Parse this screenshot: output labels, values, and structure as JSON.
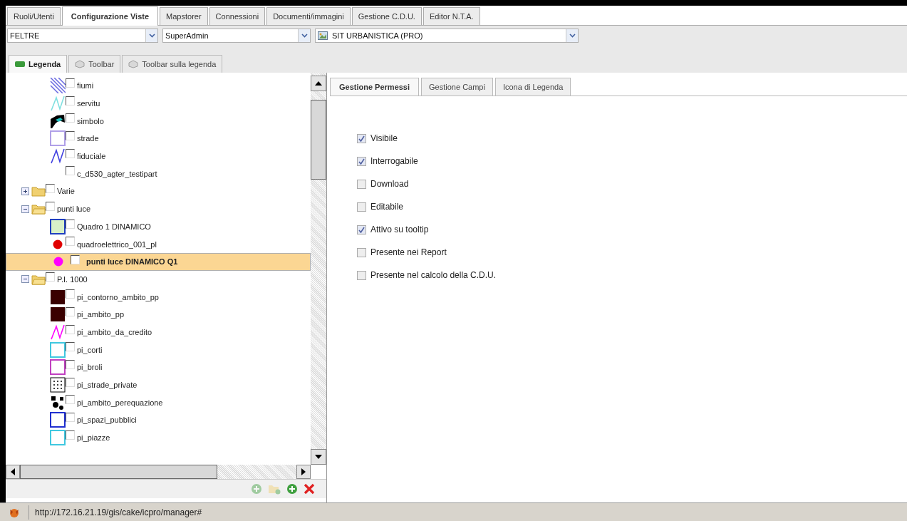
{
  "top_tabs": [
    {
      "label": "Ruoli/Utenti",
      "selected": false
    },
    {
      "label": "Configurazione Viste",
      "selected": true
    },
    {
      "label": "Mapstorer",
      "selected": false
    },
    {
      "label": "Connessioni",
      "selected": false
    },
    {
      "label": "Documenti/immagini",
      "selected": false
    },
    {
      "label": "Gestione C.D.U.",
      "selected": false
    },
    {
      "label": "Editor N.T.A.",
      "selected": false
    }
  ],
  "selectors": [
    {
      "value": "FELTRE",
      "kind": "plain"
    },
    {
      "value": "SuperAdmin",
      "kind": "plain"
    },
    {
      "value": "SIT URBANISTICA (PRO)",
      "kind": "icon"
    }
  ],
  "legend_tabs": [
    {
      "label": "Legenda",
      "selected": true
    },
    {
      "label": "Toolbar",
      "selected": false
    },
    {
      "label": "Toolbar sulla legenda",
      "selected": false
    }
  ],
  "tree": [
    {
      "children": [
        {
          "label": "fiumi",
          "kind": "hatch",
          "color": "#6a6ae0",
          "checked": false,
          "selected": false
        },
        {
          "label": "servitu",
          "kind": "line",
          "color": "#80e0e0",
          "checked": false,
          "selected": false
        },
        {
          "label": "simbolo",
          "kind": "blob-accent",
          "checked": false,
          "selected": false
        },
        {
          "label": "strade",
          "kind": "square",
          "color": "#b0a0e8",
          "checked": false,
          "selected": false
        },
        {
          "label": "fiduciale",
          "kind": "line",
          "color": "#4040e0",
          "checked": false,
          "selected": false
        },
        {
          "label": "c_d530_agter_testipart",
          "kind": "none",
          "checked": false,
          "selected": false
        }
      ]
    },
    {
      "label": "Varie",
      "kind": "folder",
      "expanded": false,
      "checked": false,
      "selected": false
    },
    {
      "label": "punti luce",
      "kind": "folder",
      "expanded": true,
      "checked": false,
      "selected": false,
      "children": [
        {
          "label": "Quadro 1 DINAMICO",
          "kind": "filled-square",
          "color": "#2040c0",
          "checked": false,
          "selected": false
        },
        {
          "label": "quadroelettrico_001_pl",
          "kind": "dot",
          "color": "#e00000",
          "checked": false,
          "selected": false
        },
        {
          "label": "punti luce DINAMICO Q1",
          "kind": "dot",
          "color": "#ff00ff",
          "checked": false,
          "selected": true
        }
      ]
    },
    {
      "label": "P.I. 1000",
      "kind": "folder",
      "expanded": true,
      "checked": false,
      "selected": false,
      "children": [
        {
          "label": "pi_contorno_ambito_pp",
          "kind": "solid",
          "color": "#3a0000",
          "checked": false,
          "selected": false
        },
        {
          "label": "pi_ambito_pp",
          "kind": "solid",
          "color": "#3a0000",
          "checked": false,
          "selected": false
        },
        {
          "label": "pi_ambito_da_credito",
          "kind": "line",
          "color": "#ff00ff",
          "checked": false,
          "selected": false
        },
        {
          "label": "pi_corti",
          "kind": "square",
          "color": "#40c8e0",
          "checked": false,
          "selected": false
        },
        {
          "label": "pi_broli",
          "kind": "square",
          "color": "#c040c0",
          "checked": false,
          "selected": false
        },
        {
          "label": "pi_strade_private",
          "kind": "dotgrid",
          "checked": false,
          "selected": false
        },
        {
          "label": "pi_ambito_perequazione",
          "kind": "blob",
          "checked": false,
          "selected": false
        },
        {
          "label": "pi_spazi_pubblici",
          "kind": "square",
          "color": "#2030d0",
          "checked": false,
          "selected": false
        },
        {
          "label": "pi_piazze",
          "kind": "square",
          "color": "#40c8e0",
          "checked": false,
          "selected": false
        }
      ]
    }
  ],
  "tree_actions": [
    {
      "kind": "add",
      "disabled": true
    },
    {
      "kind": "folder-add",
      "disabled": true
    },
    {
      "kind": "add",
      "disabled": false
    },
    {
      "kind": "delete",
      "disabled": false
    }
  ],
  "detail_tabs": [
    {
      "label": "Gestione Permessi",
      "selected": true
    },
    {
      "label": "Gestione Campi",
      "selected": false
    },
    {
      "label": "Icona di Legenda",
      "selected": false
    }
  ],
  "permissions": [
    {
      "label": "Visibile",
      "checked": true
    },
    {
      "label": "Interrogabile",
      "checked": true
    },
    {
      "label": "Download",
      "checked": false
    },
    {
      "label": "Editabile",
      "checked": false
    },
    {
      "label": "Attivo su tooltip",
      "checked": true
    },
    {
      "label": "Presente nei Report",
      "checked": false
    },
    {
      "label": "Presente nel calcolo della C.D.U.",
      "checked": false
    }
  ],
  "status_bar": {
    "url": "http://172.16.21.19/gis/cake/icpro/manager#"
  }
}
